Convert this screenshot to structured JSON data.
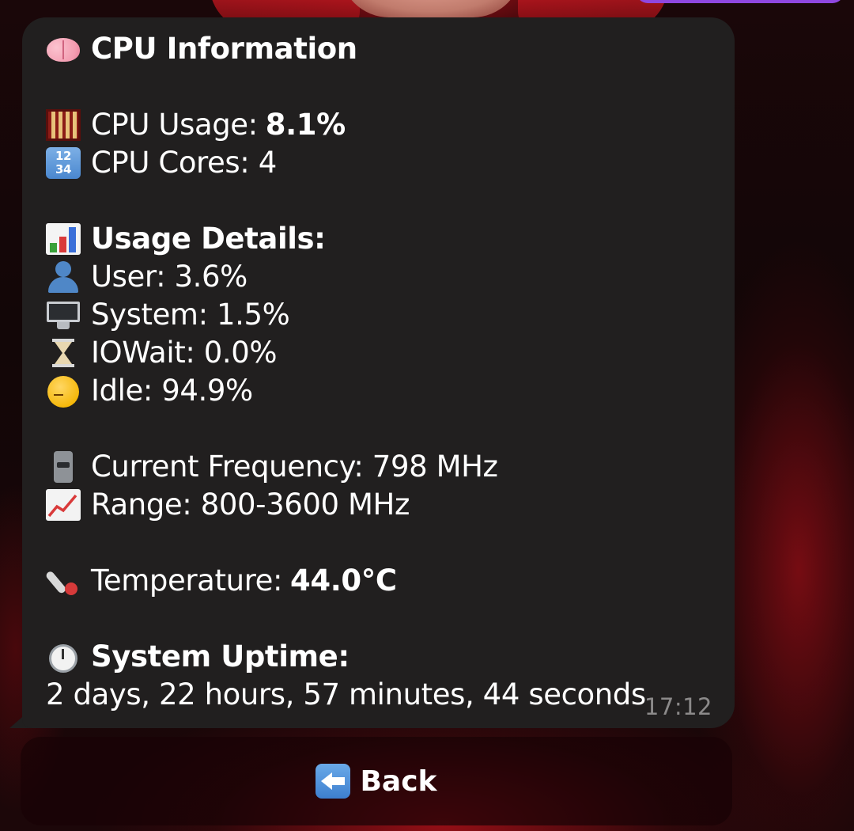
{
  "message": {
    "title": "CPU Information",
    "cpu_usage_label": "CPU Usage: ",
    "cpu_usage_value": "8.1%",
    "cpu_cores": "CPU Cores: 4",
    "usage_details_heading": "Usage Details:",
    "user": "User: 3.6%",
    "system": "System: 1.5%",
    "iowait": "IOWait: 0.0%",
    "idle": "Idle: 94.9%",
    "current_frequency": "Current Frequency: 798 MHz",
    "range": "Range: 800-3600 MHz",
    "temperature_label": "Temperature: ",
    "temperature_value": "44.0°C",
    "uptime_heading": "System Uptime:",
    "uptime_value": "2 days, 22 hours, 57 minutes, 44 seconds",
    "time": "17:12"
  },
  "keyboard": {
    "back_label": "Back"
  },
  "icons": {
    "title": "brain-icon",
    "cpu_usage": "abacus-icon",
    "cpu_cores": "numbers-icon",
    "usage_details": "bar-chart-icon",
    "user": "user-icon",
    "system": "monitor-icon",
    "iowait": "hourglass-icon",
    "idle": "sleeping-face-icon",
    "frequency": "slider-icon",
    "range": "trend-up-icon",
    "temperature": "thermometer-icon",
    "uptime": "stopwatch-icon",
    "back": "left-arrow-icon"
  },
  "colors": {
    "bubble_bg": "#211f1f",
    "text": "#ffffff",
    "timestamp": "#8c8a8a",
    "accent_tab": "#8f47e0"
  }
}
